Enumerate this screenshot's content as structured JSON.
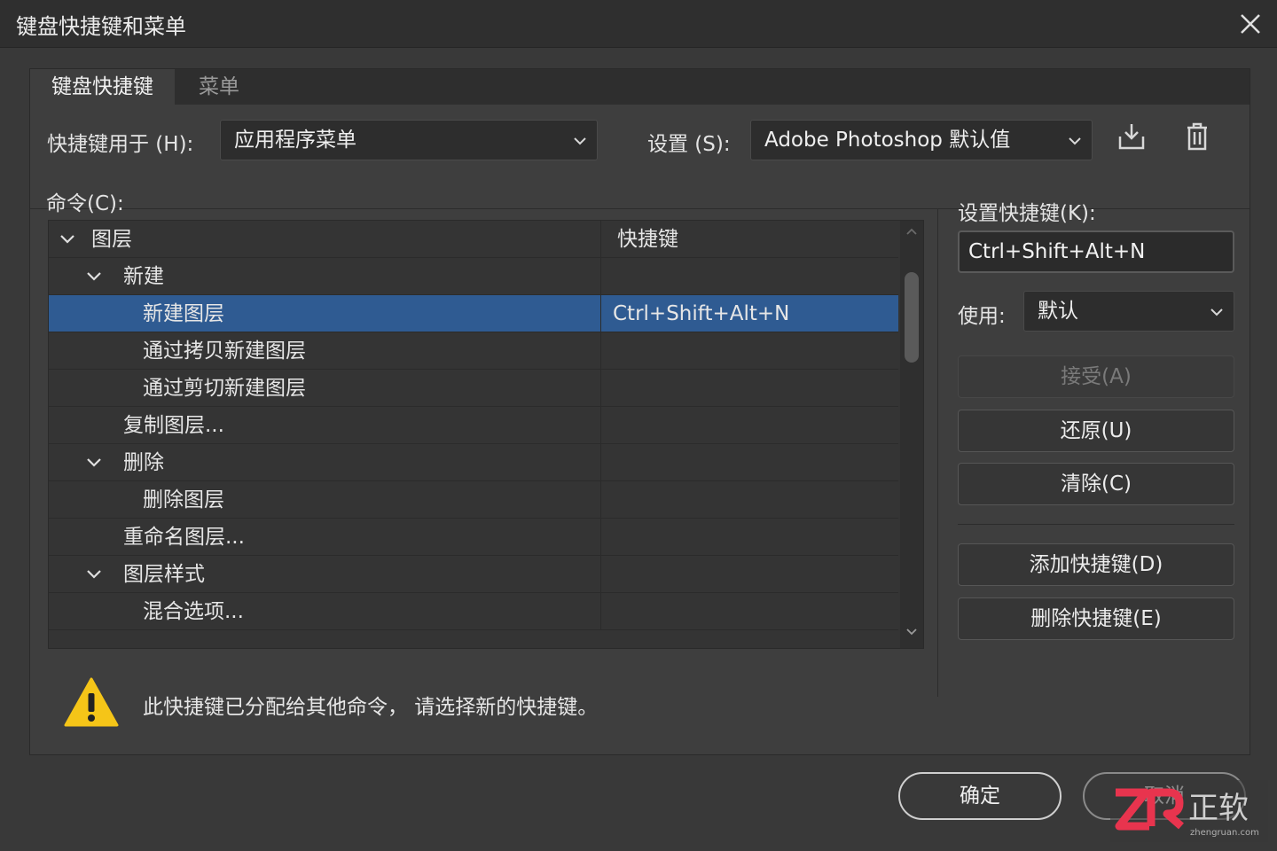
{
  "window": {
    "title": "键盘快捷键和菜单"
  },
  "tabs": [
    {
      "label": "键盘快捷键",
      "active": true
    },
    {
      "label": "菜单",
      "active": false
    }
  ],
  "shortcuts_for": {
    "label": "快捷键用于 (H):",
    "value": "应用程序菜单"
  },
  "set": {
    "label": "设置 (S):",
    "value": "Adobe Photoshop 默认值"
  },
  "commands_label": "命令(C):",
  "table": {
    "header": {
      "name": "图层",
      "key": "快捷键"
    },
    "rows": [
      {
        "name": "新建",
        "key": ""
      },
      {
        "name": "新建图层",
        "key": "Ctrl+Shift+Alt+N",
        "selected": true
      },
      {
        "name": "通过拷贝新建图层",
        "key": ""
      },
      {
        "name": "通过剪切新建图层",
        "key": ""
      },
      {
        "name": "复制图层...",
        "key": ""
      },
      {
        "name": "删除",
        "key": ""
      },
      {
        "name": "删除图层",
        "key": ""
      },
      {
        "name": "重命名图层...",
        "key": ""
      },
      {
        "name": "图层样式",
        "key": ""
      },
      {
        "name": "混合选项...",
        "key": ""
      }
    ]
  },
  "right": {
    "set_shortcut_label": "设置快捷键(K):",
    "shortcut_value": "Ctrl+Shift+Alt+N",
    "use_label": "使用:",
    "use_value": "默认",
    "accept": "接受(A)",
    "undo": "还原(U)",
    "clear": "清除(C)",
    "add": "添加快捷键(D)",
    "delete": "删除快捷键(E)"
  },
  "warning": "此快捷键已分配给其他命令， 请选择新的快捷键。",
  "footer": {
    "ok": "确定",
    "cancel": "取消"
  },
  "watermark": {
    "brand": "正软",
    "site": "zhengruan.com"
  },
  "colors": {
    "selection": "#2f5b92",
    "warning": "#f5c518",
    "watermark": "#e8344e"
  }
}
